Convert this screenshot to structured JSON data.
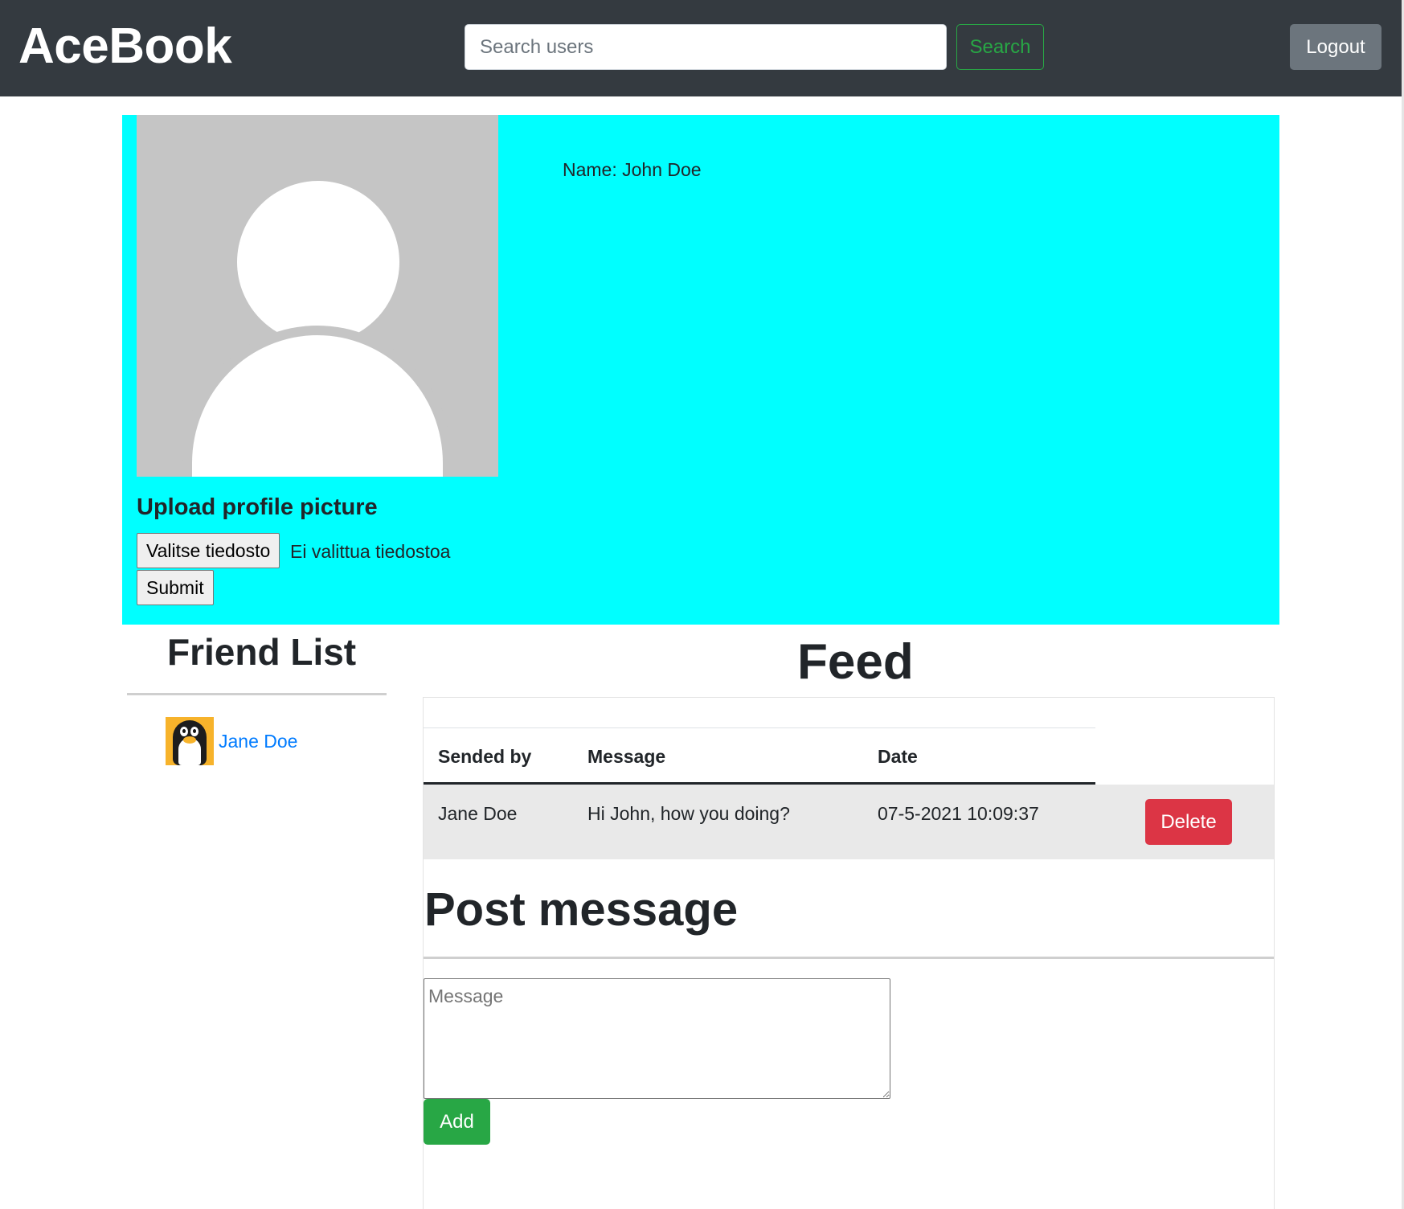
{
  "navbar": {
    "brand": "AceBook",
    "search_placeholder": "Search users",
    "search_label": "Search",
    "logout_label": "Logout"
  },
  "profile": {
    "name_text": "Name: John Doe",
    "upload_title": "Upload profile picture",
    "file_button_label": "Valitse tiedosto",
    "file_status": "Ei valittua tiedostoa",
    "submit_label": "Submit"
  },
  "friends": {
    "title": "Friend List",
    "items": [
      {
        "name": "Jane Doe",
        "avatar_icon": "penguin-icon"
      }
    ]
  },
  "feed": {
    "title": "Feed",
    "columns": [
      "Sended by",
      "Message",
      "Date"
    ],
    "rows": [
      {
        "sender": "Jane Doe",
        "message": "Hi John, how you doing?",
        "date": "07-5-2021 10:09:37",
        "delete_label": "Delete"
      }
    ]
  },
  "post": {
    "title": "Post message",
    "message_placeholder": "Message",
    "add_label": "Add"
  },
  "colors": {
    "navbar": "#343a40",
    "profile_bg": "#00ffff",
    "success": "#28a745",
    "danger": "#dc3545",
    "link": "#007bff",
    "secondary": "#6c757d"
  }
}
